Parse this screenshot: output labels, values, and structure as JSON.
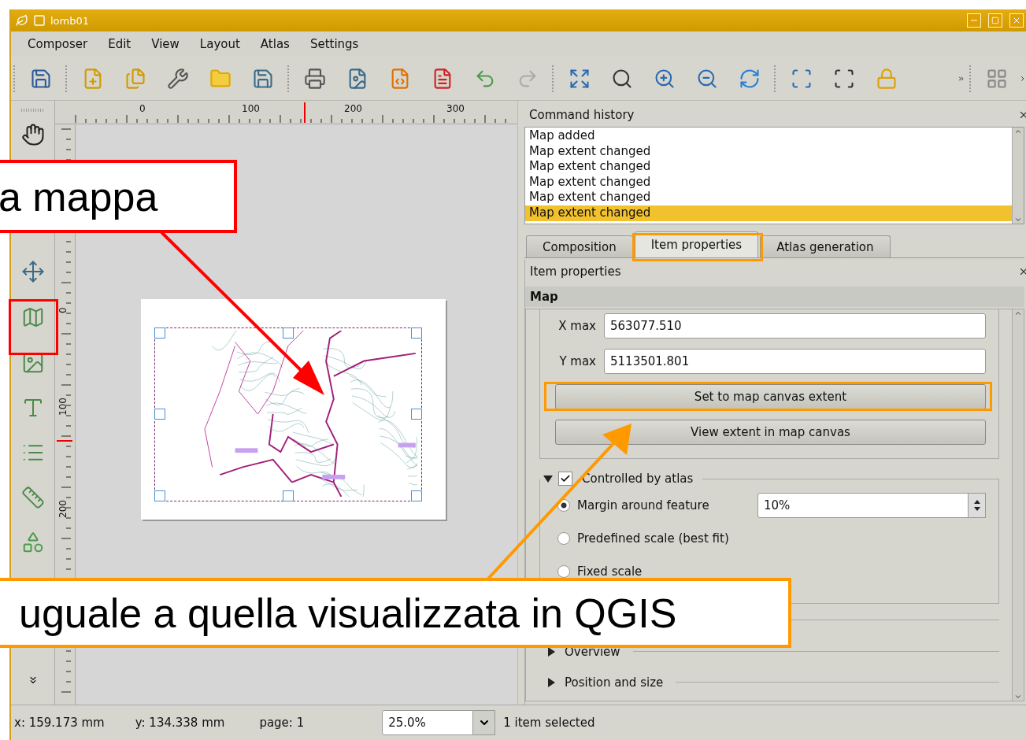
{
  "window": {
    "title": "lomb01"
  },
  "menu": [
    "Composer",
    "Edit",
    "View",
    "Layout",
    "Atlas",
    "Settings"
  ],
  "toolbar": {
    "redo_disabled": true
  },
  "rulers": {
    "horizontal": [
      "0",
      "100",
      "200",
      "300"
    ],
    "vertical": [
      "0",
      "100",
      "200"
    ]
  },
  "command_history": {
    "title": "Command history",
    "items": [
      {
        "label": "Map added",
        "selected": false
      },
      {
        "label": "Map extent changed",
        "selected": false
      },
      {
        "label": "Map extent changed",
        "selected": false
      },
      {
        "label": "Map extent changed",
        "selected": false
      },
      {
        "label": "Map extent changed",
        "selected": false
      },
      {
        "label": "Map extent changed",
        "selected": true
      }
    ]
  },
  "tabs": [
    {
      "label": "Composition",
      "selected": false
    },
    {
      "label": "Item properties",
      "selected": true
    },
    {
      "label": "Atlas generation",
      "selected": false
    }
  ],
  "item_properties": {
    "title": "Item properties",
    "section": "Map",
    "fields": [
      {
        "label": "X max",
        "value": "563077.510"
      },
      {
        "label": "Y max",
        "value": "5113501.801"
      }
    ],
    "buttons": [
      "Set to map canvas extent",
      "View extent in map canvas"
    ],
    "atlas_group": {
      "title": "Controlled by atlas",
      "expanded": true,
      "checked": true,
      "options": [
        {
          "label": "Margin around feature",
          "selected": true,
          "value": "10%"
        },
        {
          "label": "Predefined scale (best fit)",
          "selected": false
        },
        {
          "label": "Fixed scale",
          "selected": false
        }
      ]
    },
    "groups": [
      {
        "title": "Overview",
        "expanded": false
      },
      {
        "title": "Position and size",
        "expanded": false
      }
    ]
  },
  "status_bar": {
    "x": "x: 159.173 mm",
    "y": "y: 134.338 mm",
    "page": "page: 1",
    "zoom": "25.0%",
    "selection": "1 item selected"
  },
  "annotations": [
    {
      "text": "a mappa",
      "color": "#ff0000"
    },
    {
      "text": "uguale a quella visualizzata in QGIS",
      "color": "#ff9900"
    }
  ]
}
